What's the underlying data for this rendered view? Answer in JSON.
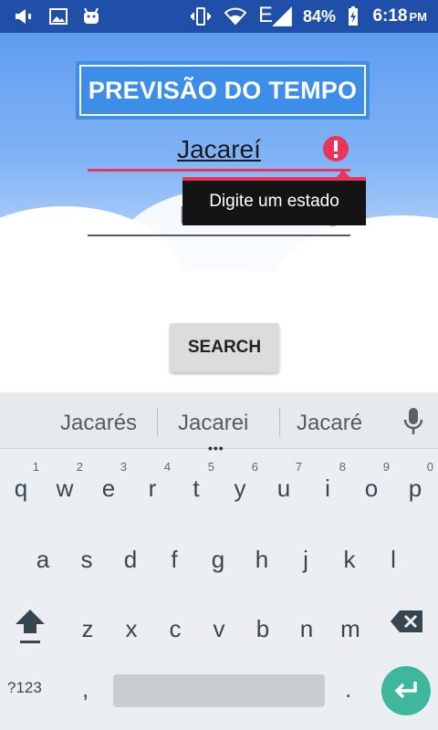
{
  "status_bar": {
    "network": "E",
    "battery_percent": "84%",
    "time": "6:18",
    "ampm": "PM"
  },
  "app": {
    "title": "PREVISÃO DO TEMPO",
    "city_value": "Jacareí",
    "state_placeholder": "Estado",
    "error_message": "Digite um estado",
    "search_label": "SEARCH"
  },
  "keyboard": {
    "suggestions": [
      "Jacarés",
      "Jacarei",
      "Jacaré"
    ],
    "more": "•••",
    "row1": [
      {
        "ch": "q",
        "num": "1"
      },
      {
        "ch": "w",
        "num": "2"
      },
      {
        "ch": "e",
        "num": "3"
      },
      {
        "ch": "r",
        "num": "4"
      },
      {
        "ch": "t",
        "num": "5"
      },
      {
        "ch": "y",
        "num": "6"
      },
      {
        "ch": "u",
        "num": "7"
      },
      {
        "ch": "i",
        "num": "8"
      },
      {
        "ch": "o",
        "num": "9"
      },
      {
        "ch": "p",
        "num": "0"
      }
    ],
    "row2": [
      "a",
      "s",
      "d",
      "f",
      "g",
      "h",
      "j",
      "k",
      "l"
    ],
    "row3": [
      "z",
      "x",
      "c",
      "v",
      "b",
      "n",
      "m"
    ],
    "symbols_label": "?123",
    "comma": ",",
    "period": "."
  },
  "colors": {
    "status_bar": "#1f4fa8",
    "title_bg": "#3d8ee8",
    "error_accent": "#e8355a",
    "enter_key": "#3fb79c"
  }
}
